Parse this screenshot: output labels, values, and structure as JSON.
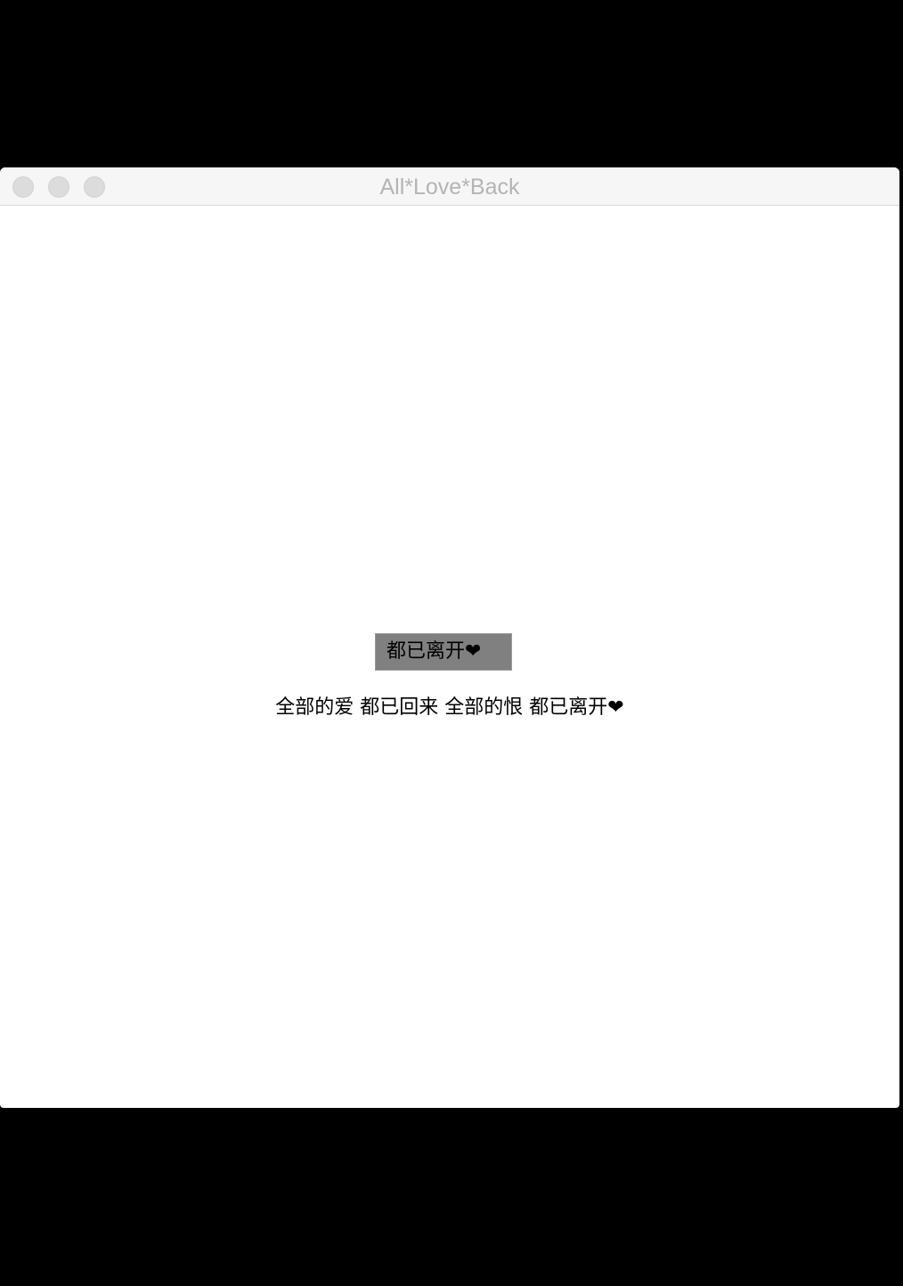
{
  "window": {
    "title": "All*Love*Back"
  },
  "main": {
    "button_label": "都已离开❤",
    "lyric_text": "全部的爱 都已回来 全部的恨 都已离开❤"
  },
  "colors": {
    "button_bg": "#808080",
    "titlebar_bg": "#f6f6f6",
    "title_text": "#b4b4b4"
  }
}
